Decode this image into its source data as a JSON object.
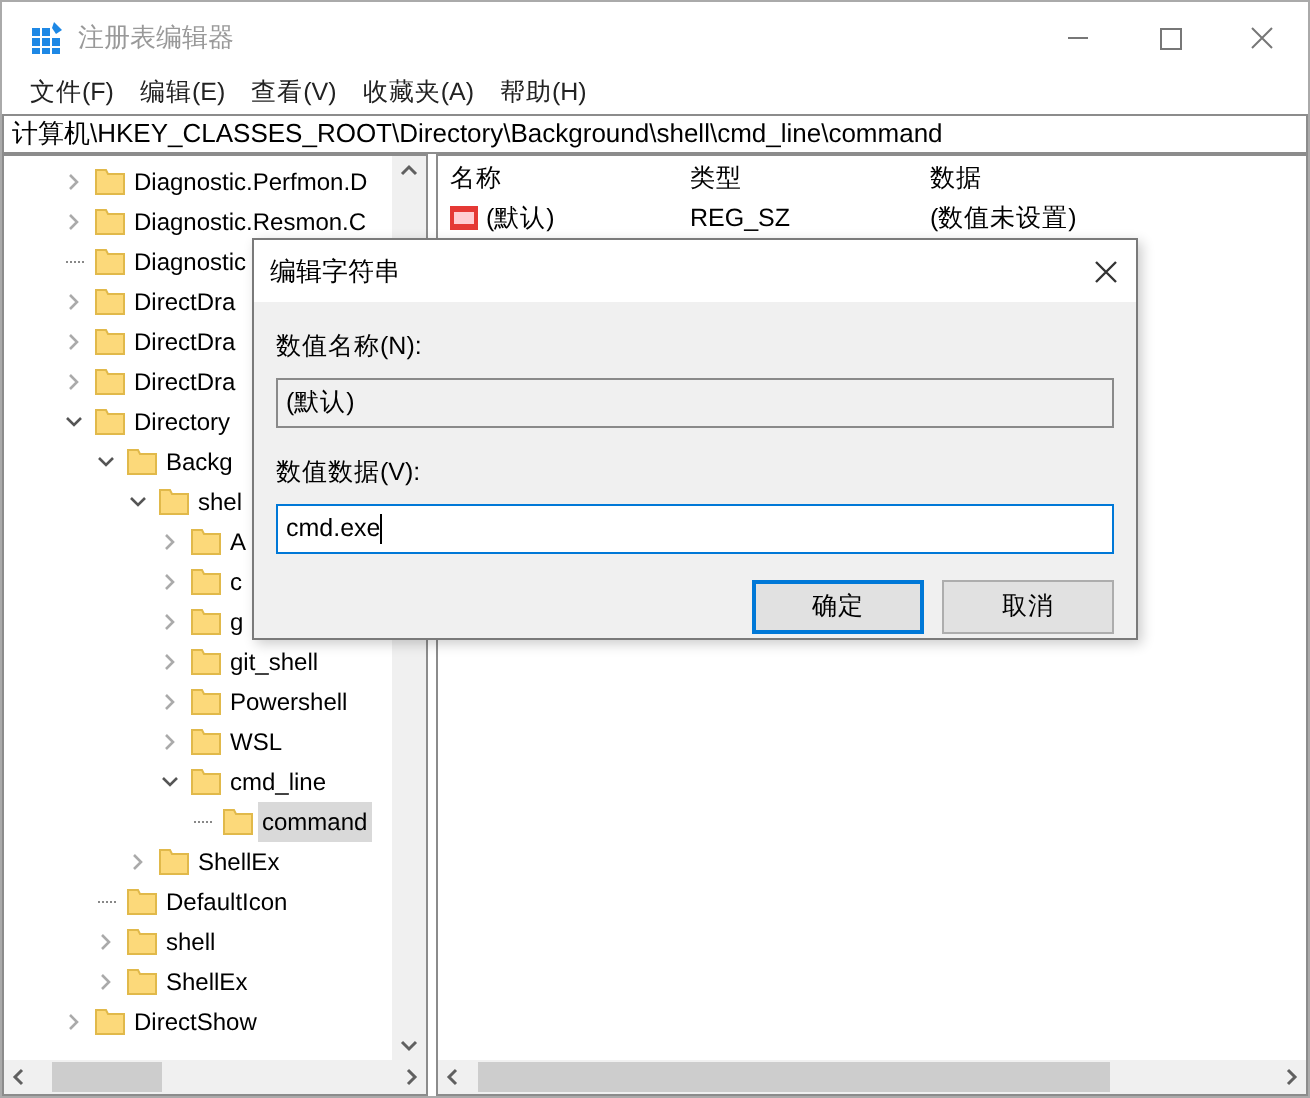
{
  "window": {
    "title": "注册表编辑器"
  },
  "menu": [
    "文件(F)",
    "编辑(E)",
    "查看(V)",
    "收藏夹(A)",
    "帮助(H)"
  ],
  "address": "计算机\\HKEY_CLASSES_ROOT\\Directory\\Background\\shell\\cmd_line\\command",
  "tree": [
    {
      "label": "Diagnostic.Perfmon.D",
      "kind": "branch",
      "expanded": false,
      "selected": false
    },
    {
      "label": "Diagnostic.Resmon.C",
      "kind": "branch",
      "expanded": false,
      "selected": false
    },
    {
      "label": "Diagnostic",
      "kind": "leaf",
      "selected": false
    },
    {
      "label": "DirectDra",
      "kind": "branch",
      "expanded": false,
      "selected": false
    },
    {
      "label": "DirectDra",
      "kind": "branch",
      "expanded": false,
      "selected": false
    },
    {
      "label": "DirectDra",
      "kind": "branch",
      "expanded": false,
      "selected": false
    },
    {
      "label": "Directory",
      "kind": "branch",
      "expanded": true,
      "selected": false,
      "children": [
        {
          "label": "Backg",
          "kind": "branch",
          "expanded": true,
          "selected": false,
          "children": [
            {
              "label": "shel",
              "kind": "branch",
              "expanded": true,
              "selected": false,
              "children": [
                {
                  "label": "A",
                  "kind": "branch",
                  "expanded": false,
                  "selected": false
                },
                {
                  "label": "c",
                  "kind": "branch",
                  "expanded": false,
                  "selected": false
                },
                {
                  "label": "g",
                  "kind": "branch",
                  "expanded": false,
                  "selected": false
                },
                {
                  "label": "git_shell",
                  "kind": "branch",
                  "expanded": false,
                  "selected": false
                },
                {
                  "label": "Powershell",
                  "kind": "branch",
                  "expanded": false,
                  "selected": false
                },
                {
                  "label": "WSL",
                  "kind": "branch",
                  "expanded": false,
                  "selected": false
                },
                {
                  "label": "cmd_line",
                  "kind": "branch",
                  "expanded": true,
                  "selected": false,
                  "children": [
                    {
                      "label": "command",
                      "kind": "leaf",
                      "selected": true
                    }
                  ]
                }
              ]
            },
            {
              "label": "ShellEx",
              "kind": "branch",
              "expanded": false,
              "selected": false
            }
          ]
        },
        {
          "label": "DefaultIcon",
          "kind": "leaf",
          "selected": false
        },
        {
          "label": "shell",
          "kind": "branch",
          "expanded": false,
          "selected": false
        },
        {
          "label": "ShellEx",
          "kind": "branch",
          "expanded": false,
          "selected": false
        }
      ]
    },
    {
      "label": "DirectShow",
      "kind": "branch",
      "expanded": false,
      "selected": false
    }
  ],
  "list": {
    "columns": [
      "名称",
      "类型",
      "数据"
    ],
    "rows": [
      {
        "name": "(默认)",
        "type": "REG_SZ",
        "data": "(数值未设置)"
      }
    ]
  },
  "dialog": {
    "title": "编辑字符串",
    "name_label": "数值名称(N):",
    "name_value": "(默认)",
    "data_label": "数值数据(V):",
    "data_value": "cmd.exe",
    "buttons": [
      {
        "label": "确定",
        "selected": true
      },
      {
        "label": "取消",
        "selected": false
      }
    ]
  }
}
